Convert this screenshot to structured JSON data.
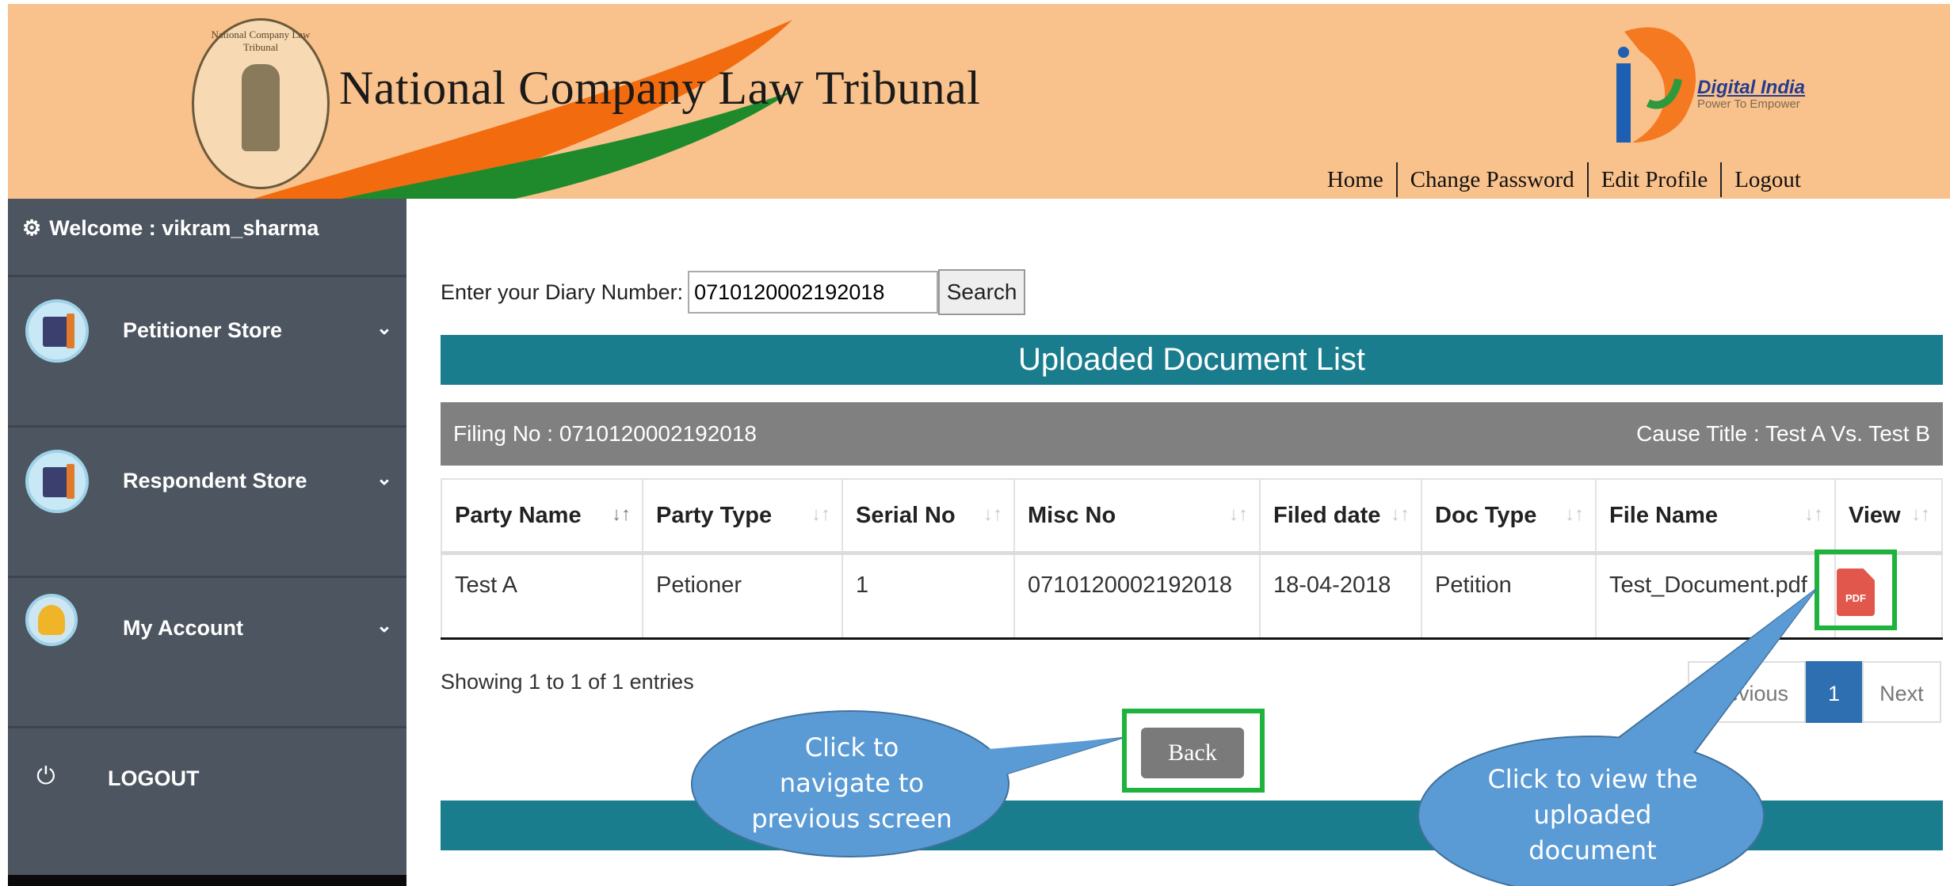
{
  "header": {
    "emblem_text": "National Company Law Tribunal",
    "site_title": "National Company Law Tribunal",
    "digital_india_title": "Digital India",
    "digital_india_subtitle": "Power To Empower",
    "nav": [
      "Home",
      "Change Password",
      "Edit Profile",
      "Logout"
    ]
  },
  "sidebar": {
    "welcome": "Welcome : vikram_sharma",
    "items": [
      {
        "label": "Petitioner Store",
        "icon": "books-icon"
      },
      {
        "label": "Respondent Store",
        "icon": "books-icon"
      },
      {
        "label": "My Account",
        "icon": "user-icon"
      }
    ],
    "logout": "LOGOUT"
  },
  "search": {
    "label": "Enter your Diary Number:",
    "value": "0710120002192018",
    "button": "Search"
  },
  "list": {
    "title": "Uploaded Document List",
    "filing_no": "Filing No : 0710120002192018",
    "cause_title": "Cause Title : Test A Vs. Test B",
    "columns": [
      "Party Name",
      "Party Type",
      "Serial No",
      "Misc No",
      "Filed date",
      "Doc Type",
      "File Name",
      "View"
    ],
    "rows": [
      {
        "party_name": "Test A",
        "party_type": "Petioner",
        "serial_no": "1",
        "misc_no": "0710120002192018",
        "filed_date": "18-04-2018",
        "doc_type": "Petition",
        "file_name": "Test_Document.pdf",
        "view_icon": "pdf-icon"
      }
    ],
    "pdf_label": "PDF",
    "showing": "Showing 1 to 1 of 1 entries",
    "pager": {
      "previous": "Previous",
      "current": "1",
      "next": "Next"
    },
    "back": "Back"
  },
  "callouts": {
    "back_line1": "Click to",
    "back_line2": "navigate to",
    "back_line3": "previous screen",
    "view_line1": "Click to view the",
    "view_line2": "uploaded",
    "view_line3": "document"
  },
  "colors": {
    "header_bg": "#f9c18b",
    "sidebar_bg": "#4d5660",
    "teal_bar": "#1a7d8e",
    "filing_bar": "#808080",
    "highlight_green": "#1db33c",
    "callout_blue": "#5b9bd5",
    "pager_active": "#2d6fb0"
  }
}
